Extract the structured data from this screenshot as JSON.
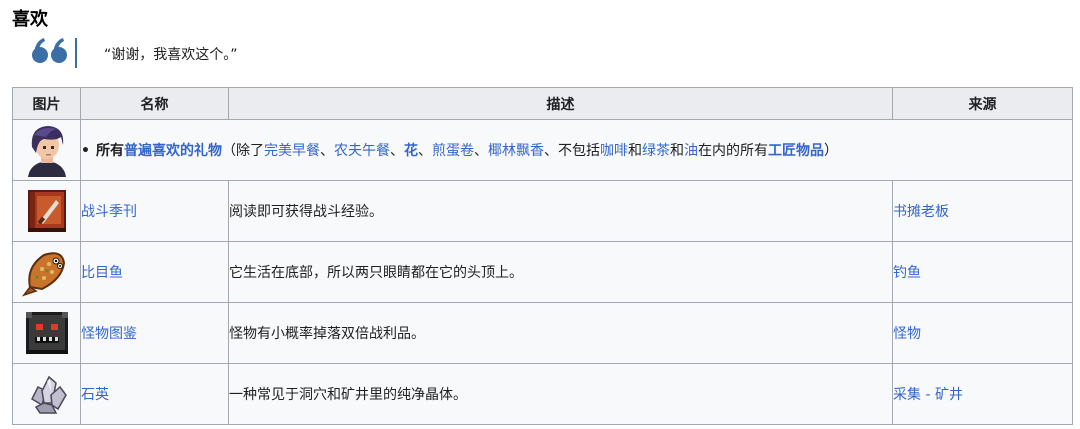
{
  "heading": "喜欢",
  "quote": {
    "icon": "quote-icon",
    "text": "“谢谢，我喜欢这个。”",
    "accent_color": "#3a6ea5"
  },
  "table": {
    "headers": [
      "图片",
      "名称",
      "描述",
      "来源"
    ],
    "universal": {
      "portrait_icon": "sebastian-portrait-icon",
      "all_text": "所有",
      "universal_link": "普遍喜欢的礼物",
      "open": "（除了",
      "ex1": "完美早餐",
      "sep1": "、",
      "ex2": "农夫午餐",
      "sep2": "、",
      "ex3": "花",
      "sep3": "、",
      "ex4": "煎蛋卷",
      "sep4": "、",
      "ex5": "椰林飘香",
      "mid": "、不包括",
      "ex6": "咖啡",
      "and1": "和",
      "ex7": "绿茶",
      "and2": "和",
      "ex8": "油",
      "tail": "在内的所有",
      "ex9": "工匠物品",
      "close": "）"
    },
    "rows": [
      {
        "icon": "combat-quarterly-book-icon",
        "name": "战斗季刊",
        "desc": "阅读即可获得战斗经验。",
        "source": "书摊老板"
      },
      {
        "icon": "flounder-fish-icon",
        "name": "比目鱼",
        "desc": "它生活在底部，所以两只眼睛都在它的头顶上。",
        "source": "钓鱼"
      },
      {
        "icon": "monster-compendium-icon",
        "name": "怪物图鉴",
        "desc": "怪物有小概率掉落双倍战利品。",
        "source": "怪物"
      },
      {
        "icon": "quartz-crystal-icon",
        "name": "石英",
        "desc": "一种常见于洞穴和矿井里的纯净晶体。",
        "source": "采集 - 矿井"
      }
    ]
  }
}
